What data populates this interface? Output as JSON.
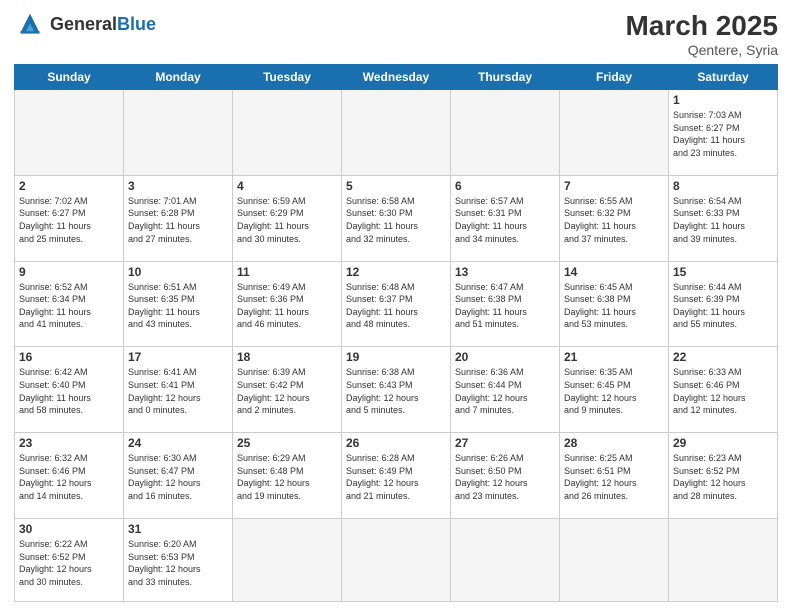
{
  "header": {
    "logo_general": "General",
    "logo_blue": "Blue",
    "title": "March 2025",
    "subtitle": "Qentere, Syria"
  },
  "weekdays": [
    "Sunday",
    "Monday",
    "Tuesday",
    "Wednesday",
    "Thursday",
    "Friday",
    "Saturday"
  ],
  "weeks": [
    [
      {
        "day": "",
        "info": ""
      },
      {
        "day": "",
        "info": ""
      },
      {
        "day": "",
        "info": ""
      },
      {
        "day": "",
        "info": ""
      },
      {
        "day": "",
        "info": ""
      },
      {
        "day": "",
        "info": ""
      },
      {
        "day": "1",
        "info": "Sunrise: 7:03 AM\nSunset: 6:27 PM\nDaylight: 11 hours\nand 23 minutes."
      }
    ],
    [
      {
        "day": "2",
        "info": "Sunrise: 7:02 AM\nSunset: 6:27 PM\nDaylight: 11 hours\nand 25 minutes."
      },
      {
        "day": "3",
        "info": "Sunrise: 7:01 AM\nSunset: 6:28 PM\nDaylight: 11 hours\nand 27 minutes."
      },
      {
        "day": "4",
        "info": "Sunrise: 6:59 AM\nSunset: 6:29 PM\nDaylight: 11 hours\nand 30 minutes."
      },
      {
        "day": "5",
        "info": "Sunrise: 6:58 AM\nSunset: 6:30 PM\nDaylight: 11 hours\nand 32 minutes."
      },
      {
        "day": "6",
        "info": "Sunrise: 6:57 AM\nSunset: 6:31 PM\nDaylight: 11 hours\nand 34 minutes."
      },
      {
        "day": "7",
        "info": "Sunrise: 6:55 AM\nSunset: 6:32 PM\nDaylight: 11 hours\nand 37 minutes."
      },
      {
        "day": "8",
        "info": "Sunrise: 6:54 AM\nSunset: 6:33 PM\nDaylight: 11 hours\nand 39 minutes."
      }
    ],
    [
      {
        "day": "9",
        "info": "Sunrise: 6:52 AM\nSunset: 6:34 PM\nDaylight: 11 hours\nand 41 minutes."
      },
      {
        "day": "10",
        "info": "Sunrise: 6:51 AM\nSunset: 6:35 PM\nDaylight: 11 hours\nand 43 minutes."
      },
      {
        "day": "11",
        "info": "Sunrise: 6:49 AM\nSunset: 6:36 PM\nDaylight: 11 hours\nand 46 minutes."
      },
      {
        "day": "12",
        "info": "Sunrise: 6:48 AM\nSunset: 6:37 PM\nDaylight: 11 hours\nand 48 minutes."
      },
      {
        "day": "13",
        "info": "Sunrise: 6:47 AM\nSunset: 6:38 PM\nDaylight: 11 hours\nand 51 minutes."
      },
      {
        "day": "14",
        "info": "Sunrise: 6:45 AM\nSunset: 6:38 PM\nDaylight: 11 hours\nand 53 minutes."
      },
      {
        "day": "15",
        "info": "Sunrise: 6:44 AM\nSunset: 6:39 PM\nDaylight: 11 hours\nand 55 minutes."
      }
    ],
    [
      {
        "day": "16",
        "info": "Sunrise: 6:42 AM\nSunset: 6:40 PM\nDaylight: 11 hours\nand 58 minutes."
      },
      {
        "day": "17",
        "info": "Sunrise: 6:41 AM\nSunset: 6:41 PM\nDaylight: 12 hours\nand 0 minutes."
      },
      {
        "day": "18",
        "info": "Sunrise: 6:39 AM\nSunset: 6:42 PM\nDaylight: 12 hours\nand 2 minutes."
      },
      {
        "day": "19",
        "info": "Sunrise: 6:38 AM\nSunset: 6:43 PM\nDaylight: 12 hours\nand 5 minutes."
      },
      {
        "day": "20",
        "info": "Sunrise: 6:36 AM\nSunset: 6:44 PM\nDaylight: 12 hours\nand 7 minutes."
      },
      {
        "day": "21",
        "info": "Sunrise: 6:35 AM\nSunset: 6:45 PM\nDaylight: 12 hours\nand 9 minutes."
      },
      {
        "day": "22",
        "info": "Sunrise: 6:33 AM\nSunset: 6:46 PM\nDaylight: 12 hours\nand 12 minutes."
      }
    ],
    [
      {
        "day": "23",
        "info": "Sunrise: 6:32 AM\nSunset: 6:46 PM\nDaylight: 12 hours\nand 14 minutes."
      },
      {
        "day": "24",
        "info": "Sunrise: 6:30 AM\nSunset: 6:47 PM\nDaylight: 12 hours\nand 16 minutes."
      },
      {
        "day": "25",
        "info": "Sunrise: 6:29 AM\nSunset: 6:48 PM\nDaylight: 12 hours\nand 19 minutes."
      },
      {
        "day": "26",
        "info": "Sunrise: 6:28 AM\nSunset: 6:49 PM\nDaylight: 12 hours\nand 21 minutes."
      },
      {
        "day": "27",
        "info": "Sunrise: 6:26 AM\nSunset: 6:50 PM\nDaylight: 12 hours\nand 23 minutes."
      },
      {
        "day": "28",
        "info": "Sunrise: 6:25 AM\nSunset: 6:51 PM\nDaylight: 12 hours\nand 26 minutes."
      },
      {
        "day": "29",
        "info": "Sunrise: 6:23 AM\nSunset: 6:52 PM\nDaylight: 12 hours\nand 28 minutes."
      }
    ],
    [
      {
        "day": "30",
        "info": "Sunrise: 6:22 AM\nSunset: 6:52 PM\nDaylight: 12 hours\nand 30 minutes."
      },
      {
        "day": "31",
        "info": "Sunrise: 6:20 AM\nSunset: 6:53 PM\nDaylight: 12 hours\nand 33 minutes."
      },
      {
        "day": "",
        "info": ""
      },
      {
        "day": "",
        "info": ""
      },
      {
        "day": "",
        "info": ""
      },
      {
        "day": "",
        "info": ""
      },
      {
        "day": "",
        "info": ""
      }
    ]
  ]
}
